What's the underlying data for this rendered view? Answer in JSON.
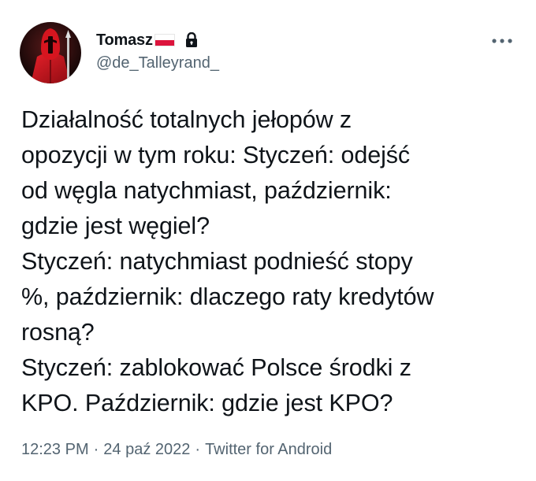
{
  "author": {
    "display_name": "Tomasz",
    "handle": "@de_Talleyrand_",
    "flag_icon": "poland-flag-icon",
    "protected_icon": "lock-icon",
    "avatar_icon": "red-guard-avatar"
  },
  "menu": {
    "more_icon": "more-options-icon"
  },
  "tweet": {
    "text": "Działalność totalnych jełopów z\nopozycji w tym roku: Styczeń: odejść\nod węgla natychmiast, październik:\ngdzie jest węgiel?\nStyczeń: natychmiast podnieść stopy\n%, październik: dlaczego raty kredytów\nrosną?\nStyczeń: zablokować Polsce środki z\nKPO. Październik: gdzie jest KPO?"
  },
  "meta": {
    "time": "12:23 PM",
    "separator": "·",
    "date": "24 paź 2022",
    "source": "Twitter for Android"
  },
  "colors": {
    "text": "#0f1419",
    "secondary": "#536471",
    "flag_red": "#dc143c"
  }
}
